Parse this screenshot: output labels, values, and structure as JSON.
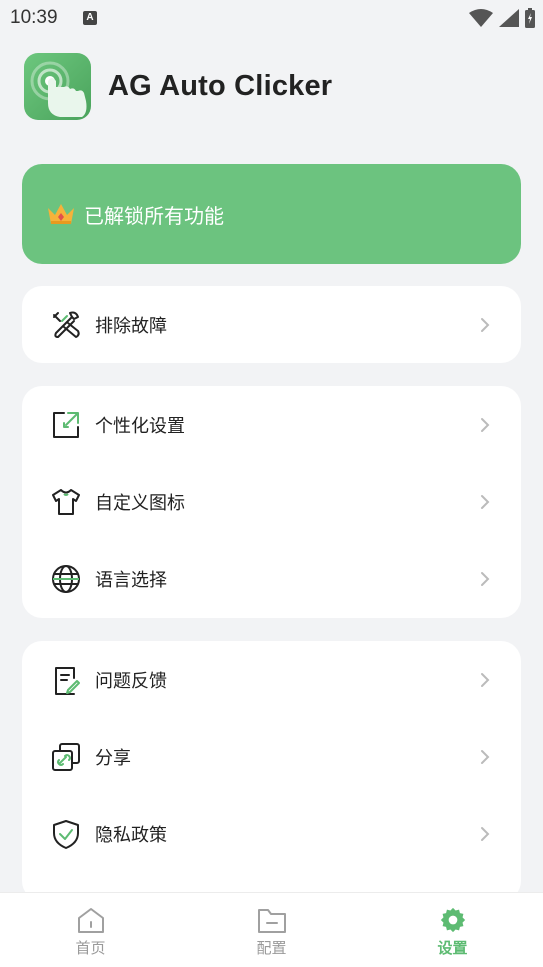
{
  "status_bar": {
    "time": "10:39",
    "notification_badge": "A"
  },
  "app": {
    "title": "AG Auto Clicker"
  },
  "premium": {
    "text": "已解锁所有功能",
    "icon": "crown-icon"
  },
  "groups": [
    {
      "items": [
        {
          "label": "排除故障",
          "icon": "tools-icon"
        }
      ]
    },
    {
      "items": [
        {
          "label": "个性化设置",
          "icon": "external-link-icon"
        },
        {
          "label": "自定义图标",
          "icon": "tshirt-icon"
        },
        {
          "label": "语言选择",
          "icon": "globe-icon"
        }
      ]
    },
    {
      "items": [
        {
          "label": "问题反馈",
          "icon": "feedback-icon"
        },
        {
          "label": "分享",
          "icon": "share-link-icon"
        },
        {
          "label": "隐私政策",
          "icon": "shield-check-icon"
        }
      ]
    }
  ],
  "nav": [
    {
      "label": "首页",
      "icon": "home-icon",
      "active": false
    },
    {
      "label": "配置",
      "icon": "folder-icon",
      "active": false
    },
    {
      "label": "设置",
      "icon": "gear-icon",
      "active": true
    }
  ],
  "colors": {
    "accent": "#5dbb72",
    "banner": "#6cc37f",
    "background": "#f2f3f5"
  }
}
